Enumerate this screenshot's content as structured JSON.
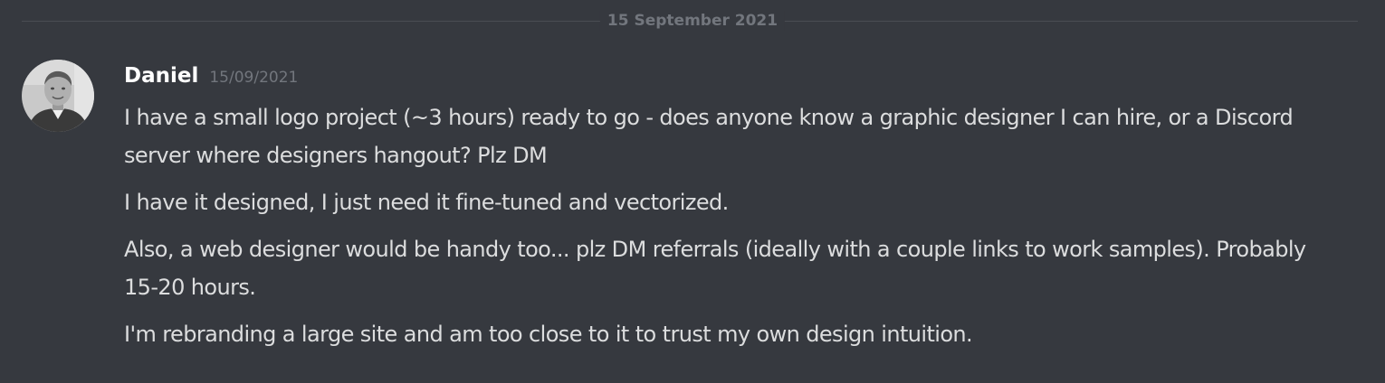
{
  "divider": {
    "date_label": "15 September 2021"
  },
  "message": {
    "author": "Daniel",
    "timestamp": "15/09/2021",
    "avatar_icon": "user-avatar-photo",
    "lines": [
      "I have a small logo project (~3 hours) ready to go - does anyone know a graphic designer I can hire, or a Discord server where designers hangout? Plz DM",
      "I have it designed, I just need it fine-tuned and vectorized.",
      "Also, a web designer would be handy too... plz DM referrals (ideally with a couple links to work samples). Probably 15-20 hours.",
      "I'm rebranding a large site and am too close to it to trust my own design intuition."
    ]
  },
  "colors": {
    "background": "#36393f",
    "username": "#ffffff",
    "text": "#dcddde",
    "muted": "#72767d",
    "divider": "#4a4d53"
  }
}
